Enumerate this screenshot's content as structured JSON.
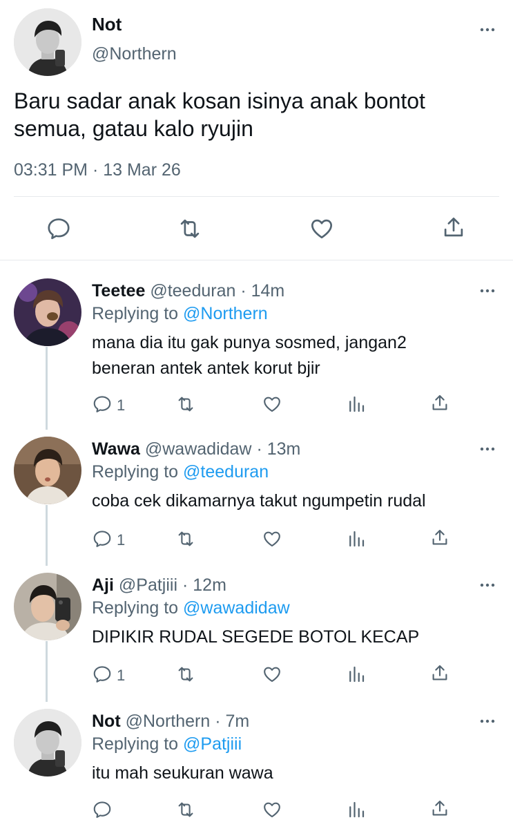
{
  "main_tweet": {
    "display_name": "Not",
    "handle": "@Northern",
    "text_line1": "Baru sadar anak kosan isinya anak bontot",
    "text_line2": "semua, gatau kalo ryujin",
    "timestamp": "03:31 PM · 13 Mar 26",
    "actions": [
      "reply-icon",
      "retweet-icon",
      "like-icon",
      "share-icon"
    ]
  },
  "replies": [
    {
      "display_name": "Teetee",
      "handle": "@teeduran",
      "time": "· 14m",
      "replying_label": "Replying to",
      "replying_to": "@Northern",
      "text_line1": "mana dia itu gak punya sosmed, jangan2",
      "text_line2": "beneran antek antek korut bjir",
      "reply_count": "1"
    },
    {
      "display_name": "Wawa",
      "handle": "@wawadidaw",
      "time": "· 13m",
      "replying_label": "Replying to",
      "replying_to": "@teeduran",
      "text_line1": "coba cek dikamarnya takut ngumpetin rudal",
      "reply_count": "1"
    },
    {
      "display_name": "Aji",
      "handle": "@Patjiii",
      "time": "· 12m",
      "replying_label": "Replying to",
      "replying_to": "@wawadidaw",
      "text_line1": "DIPIKIR RUDAL SEGEDE BOTOL KECAP",
      "reply_count": "1"
    },
    {
      "display_name": "Not",
      "handle": "@Northern",
      "time": "· 7m",
      "replying_label": "Replying to",
      "replying_to": "@Patjiii",
      "text_line1": "itu mah seukuran wawa",
      "reply_count": ""
    }
  ],
  "colors": {
    "text": "#0f1419",
    "secondary": "#536471",
    "link": "#1d9bf0",
    "divider": "#e6e9ec",
    "thread_line": "#cfd9de"
  },
  "reply_actions": [
    "reply-icon",
    "retweet-icon",
    "like-icon",
    "analytics-icon",
    "share-icon"
  ]
}
